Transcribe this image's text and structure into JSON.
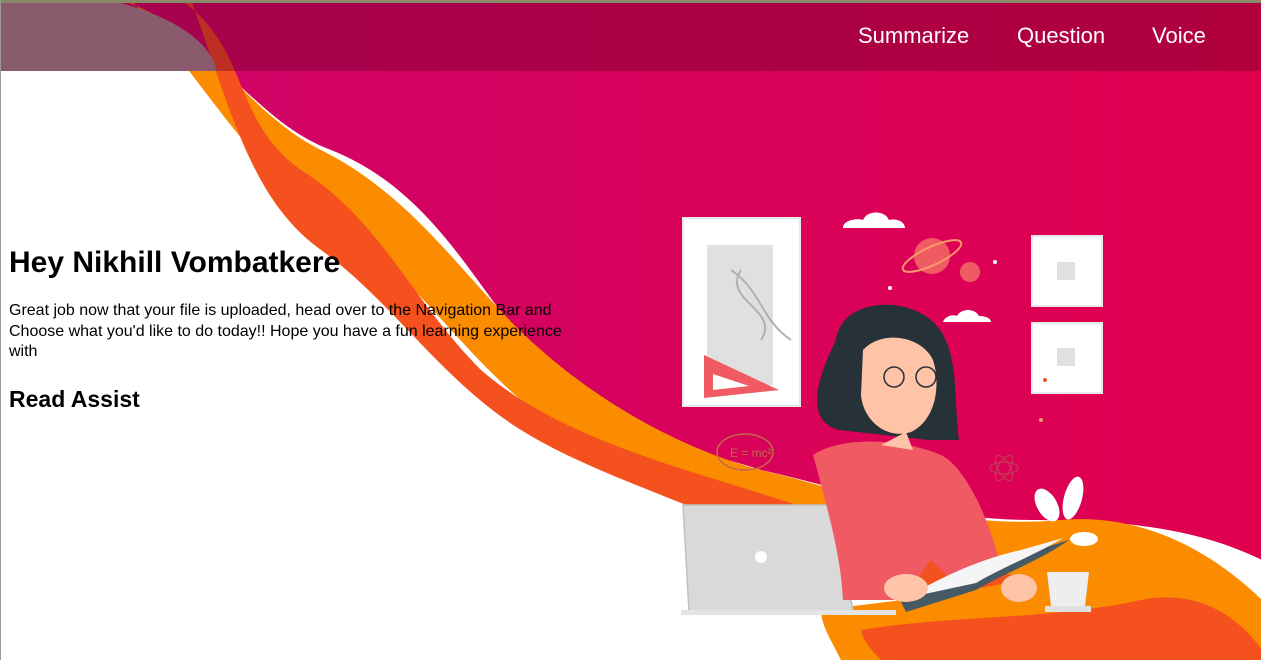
{
  "nav": {
    "items": [
      "Summarize",
      "Question",
      "Voice"
    ]
  },
  "hero": {
    "greeting": "Hey Nikhill Vombatkere",
    "message": "Great job now that your file is uploaded, head over to the Navigation Bar and Choose what you'd like to do today!! Hope you have a fun learning experience with",
    "app_name": "Read Assist"
  },
  "illustration": {
    "formula_text": "E = mc²"
  },
  "colors": {
    "magenta": "#d6005c",
    "orange": "#fb8c00",
    "orange_red": "#f4511e",
    "nav_overlay": "#6e0028",
    "shirt": "#f05a63"
  }
}
